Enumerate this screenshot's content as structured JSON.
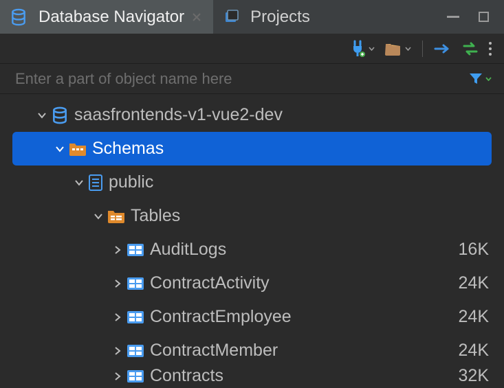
{
  "tabs": {
    "navigator": "Database Navigator",
    "projects": "Projects"
  },
  "filter": {
    "placeholder": "Enter a part of object name here"
  },
  "tree": {
    "connection": {
      "label": "saasfrontends-v1-vue2-dev"
    },
    "schemas": {
      "label": "Schemas"
    },
    "public": {
      "label": "public"
    },
    "tables": {
      "label": "Tables"
    },
    "items": [
      {
        "label": "AuditLogs",
        "size": "16K"
      },
      {
        "label": "ContractActivity",
        "size": "24K"
      },
      {
        "label": "ContractEmployee",
        "size": "24K"
      },
      {
        "label": "ContractMember",
        "size": "24K"
      },
      {
        "label": "Contracts",
        "size": "32K"
      }
    ]
  }
}
